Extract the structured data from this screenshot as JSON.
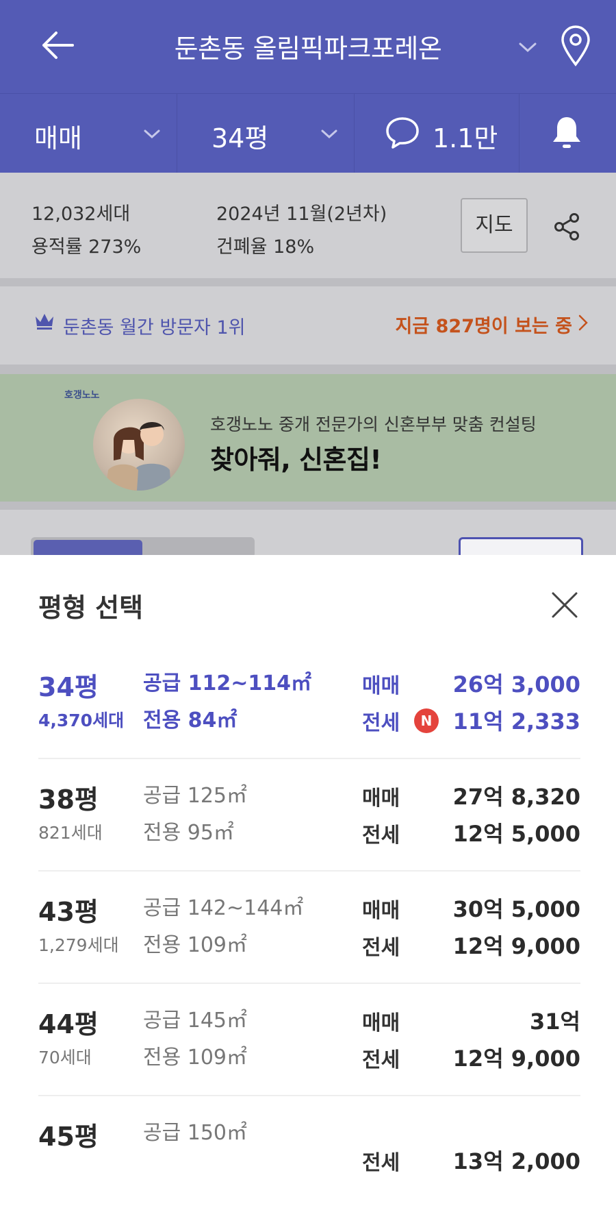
{
  "header": {
    "title": "둔촌동 올림픽파크포레온"
  },
  "tabs": {
    "trade_type": "매매",
    "area": "34평",
    "comments": "1.1만"
  },
  "info": {
    "households": "12,032세대",
    "floor_area_ratio": "용적률 273%",
    "completion": "2024년 11월(2년차)",
    "building_coverage": "건폐율 18%",
    "map_button": "지도"
  },
  "visit": {
    "rank": "둔촌동 월간 방문자 1위",
    "now_viewing": "지금 827명이 보는 중"
  },
  "banner": {
    "brand": "호갱노노",
    "subtitle": "호갱노노 중개 전문가의 신혼부부 맞춤 컨설팅",
    "title": "찾아줘, 신혼집!"
  },
  "sheet": {
    "title": "평형 선택",
    "rows": [
      {
        "pyeong": "34평",
        "households": "4,370세대",
        "supply": "공급 112~114㎡",
        "exclusive": "전용 84㎡",
        "label1": "매매",
        "price1": "26억 3,000",
        "label2": "전세",
        "badge": "N",
        "price2": "11억 2,333"
      },
      {
        "pyeong": "38평",
        "households": "821세대",
        "supply": "공급 125㎡",
        "exclusive": "전용 95㎡",
        "label1": "매매",
        "price1": "27억 8,320",
        "label2": "전세",
        "price2": "12억 5,000"
      },
      {
        "pyeong": "43평",
        "households": "1,279세대",
        "supply": "공급 142~144㎡",
        "exclusive": "전용 109㎡",
        "label1": "매매",
        "price1": "30억 5,000",
        "label2": "전세",
        "price2": "12억 9,000"
      },
      {
        "pyeong": "44평",
        "households": "70세대",
        "supply": "공급 145㎡",
        "exclusive": "전용 109㎡",
        "label1": "매매",
        "price1": "31억",
        "label2": "전세",
        "price2": "12억 9,000"
      },
      {
        "pyeong": "45평",
        "households": "",
        "supply": "공급 150㎡",
        "exclusive": "",
        "label1": "",
        "price1": "",
        "label2": "전세",
        "price2": "13억 2,000"
      }
    ]
  },
  "colors": {
    "header_bg": "#545bb5",
    "selected_text": "#4d4fc0",
    "highlight_orange": "#c4521c",
    "new_badge": "#e4433c"
  }
}
